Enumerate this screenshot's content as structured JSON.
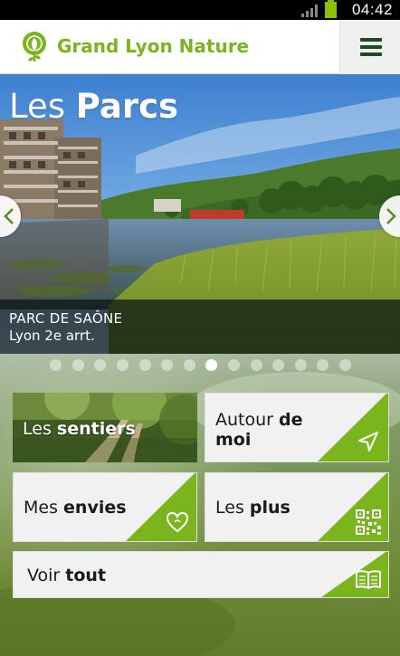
{
  "status_bar": {
    "time": "04:42"
  },
  "header": {
    "title": "Grand Lyon Nature",
    "accent": "#7ab51d",
    "menu_icon": "hamburger-menu-icon"
  },
  "hero": {
    "title_light": "Les",
    "title_bold": "Parcs",
    "caption_name": "PARC DE SAÔNE",
    "caption_location": "Lyon 2e arrt.",
    "slide_count": 14,
    "active_slide": 8
  },
  "tiles": [
    {
      "id": "sentiers",
      "light": "Les",
      "bold": "sentiers",
      "icon": "photo-trail"
    },
    {
      "id": "autour",
      "light": "Autour",
      "bold": "de moi",
      "icon": "location-arrow-icon"
    },
    {
      "id": "envies",
      "light": "Mes",
      "bold": "envies",
      "icon": "heart-icon"
    },
    {
      "id": "plus",
      "light": "Les",
      "bold": "plus",
      "icon": "qr-code-icon"
    },
    {
      "id": "tout",
      "light": "Voir",
      "bold": "tout",
      "icon": "book-icon"
    }
  ]
}
